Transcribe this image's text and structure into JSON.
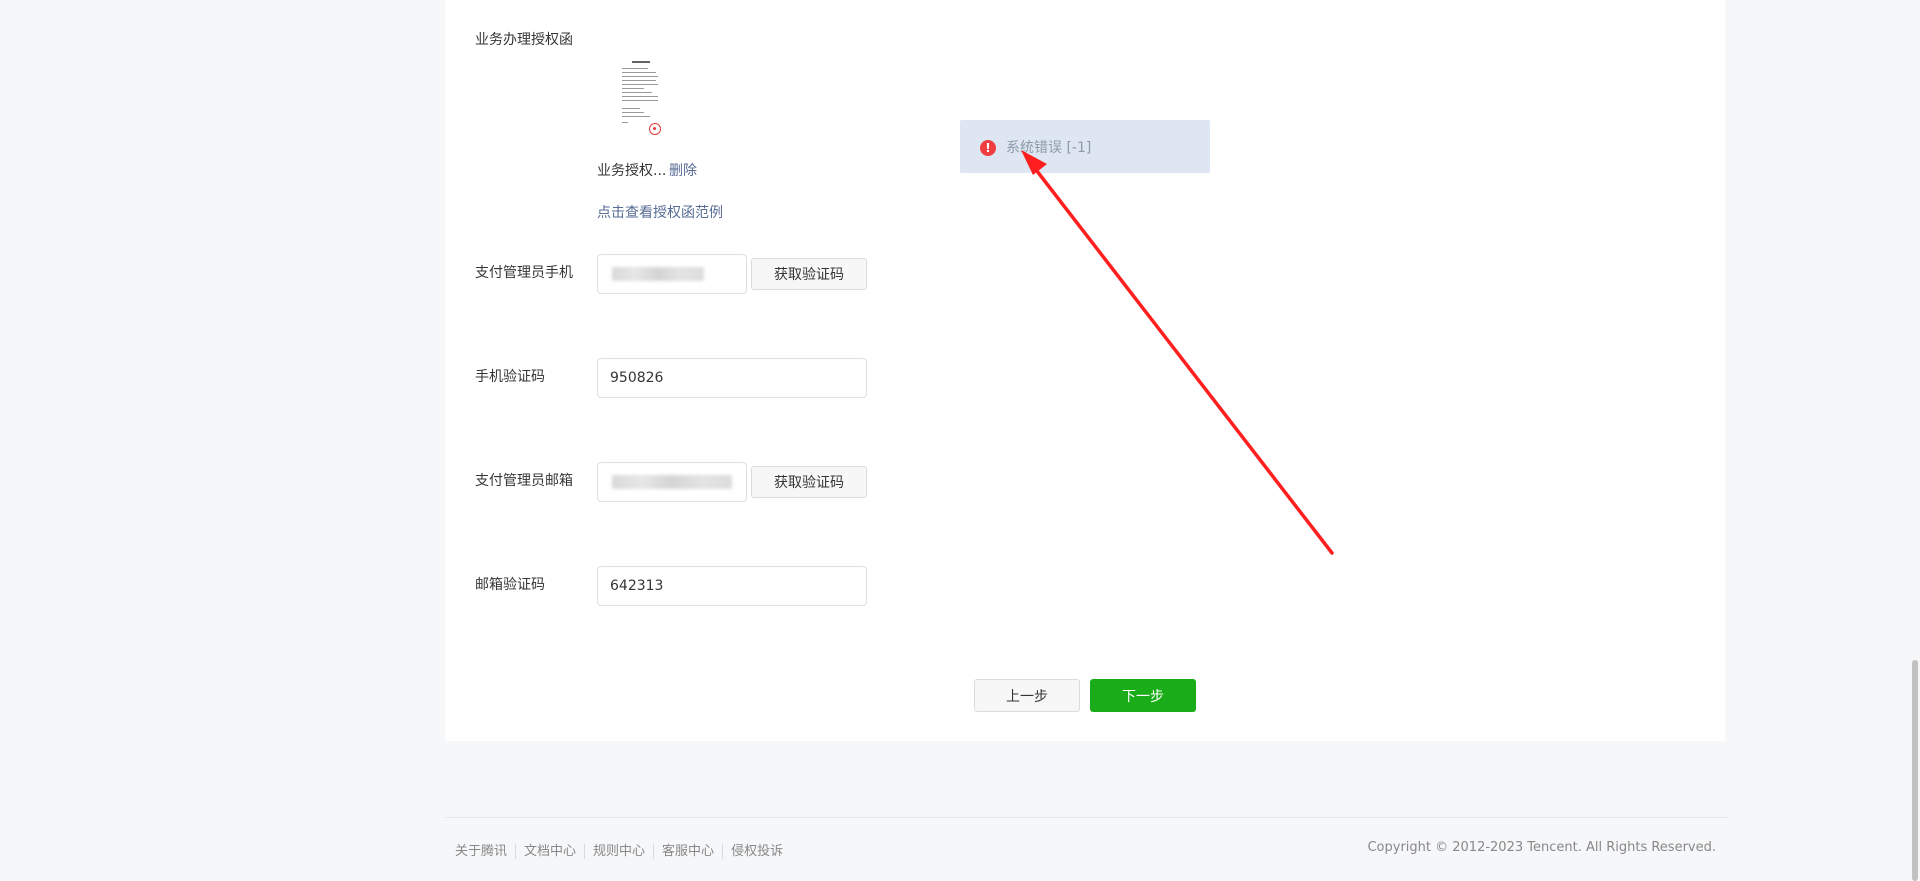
{
  "form": {
    "auth_letter": {
      "label": "业务办理授权函",
      "file_name": "业务授权...",
      "delete_label": "删除",
      "example_link": "点击查看授权函范例"
    },
    "admin_phone": {
      "label": "支付管理员手机",
      "get_code_label": "获取验证码"
    },
    "phone_code": {
      "label": "手机验证码",
      "value": "950826"
    },
    "admin_email": {
      "label": "支付管理员邮箱",
      "get_code_label": "获取验证码"
    },
    "email_code": {
      "label": "邮箱验证码",
      "value": "642313"
    }
  },
  "actions": {
    "prev_label": "上一步",
    "next_label": "下一步"
  },
  "toast": {
    "icon": "error-icon",
    "icon_glyph": "!",
    "message": "系统错误 [-1]"
  },
  "annotation": {
    "color": "#ff1f1f"
  },
  "footer": {
    "links": [
      "关于腾讯",
      "文档中心",
      "规则中心",
      "客服中心",
      "侵权投诉"
    ],
    "copyright": "Copyright © 2012-2023 Tencent. All Rights Reserved."
  },
  "colors": {
    "primary_green": "#1aad19",
    "link_blue": "#576b95",
    "error_red": "#ee3f3f",
    "toast_bg": "#dde6f2"
  }
}
